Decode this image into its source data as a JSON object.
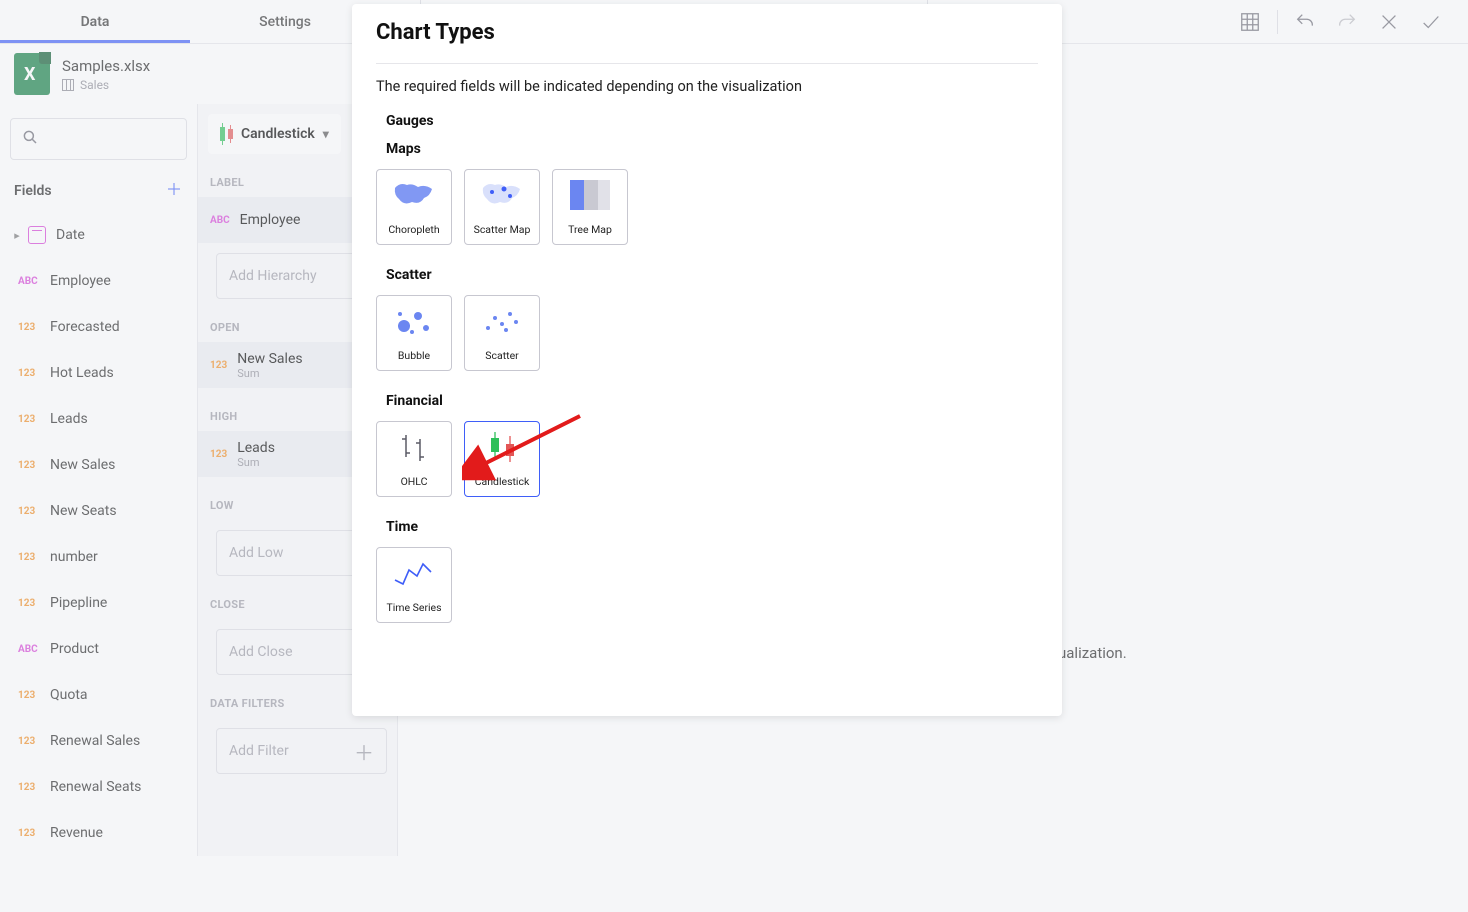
{
  "tabs": {
    "data": "Data",
    "settings": "Settings"
  },
  "file": {
    "name": "Samples.xlsx",
    "sheet": "Sales"
  },
  "fields_panel": {
    "heading": "Fields",
    "items": [
      {
        "type": "date",
        "label": "Date"
      },
      {
        "type": "abc",
        "label": "Employee"
      },
      {
        "type": "123",
        "label": "Forecasted"
      },
      {
        "type": "123",
        "label": "Hot Leads"
      },
      {
        "type": "123",
        "label": "Leads"
      },
      {
        "type": "123",
        "label": "New Sales"
      },
      {
        "type": "123",
        "label": "New Seats"
      },
      {
        "type": "123",
        "label": "number"
      },
      {
        "type": "123",
        "label": "Pipepline"
      },
      {
        "type": "abc",
        "label": "Product"
      },
      {
        "type": "123",
        "label": "Quota"
      },
      {
        "type": "123",
        "label": "Renewal Sales"
      },
      {
        "type": "123",
        "label": "Renewal Seats"
      },
      {
        "type": "123",
        "label": "Revenue"
      }
    ]
  },
  "chart_picker": {
    "current": "Candlestick"
  },
  "config": {
    "label_section": "LABEL",
    "label_chip": {
      "type": "ABC",
      "name": "Employee"
    },
    "label_well": "Add Hierarchy",
    "open_section": "OPEN",
    "open_chip": {
      "type": "123",
      "name": "New Sales",
      "agg": "Sum"
    },
    "high_section": "HIGH",
    "high_chip": {
      "type": "123",
      "name": "Leads",
      "agg": "Sum"
    },
    "low_section": "LOW",
    "low_well": "Add Low",
    "close_section": "CLOSE",
    "close_well": "Add Close",
    "filters_section": "DATA FILTERS",
    "filters_well": "Add Filter"
  },
  "canvas": {
    "hint_tail": "ualization."
  },
  "modal": {
    "title": "Chart Types",
    "desc": "The required fields will be indicated depending on the visualization",
    "cat_gauges": "Gauges",
    "cat_maps": "Maps",
    "cat_scatter": "Scatter",
    "cat_fin": "Financial",
    "cat_time": "Time",
    "opt_choropleth": "Choropleth",
    "opt_scattermap": "Scatter Map",
    "opt_treemap": "Tree Map",
    "opt_bubble": "Bubble",
    "opt_scatter": "Scatter",
    "opt_ohlc": "OHLC",
    "opt_candle": "Candlestick",
    "opt_timeseries": "Time Series"
  },
  "types": {
    "abc": "ABC",
    "n123": "123"
  }
}
